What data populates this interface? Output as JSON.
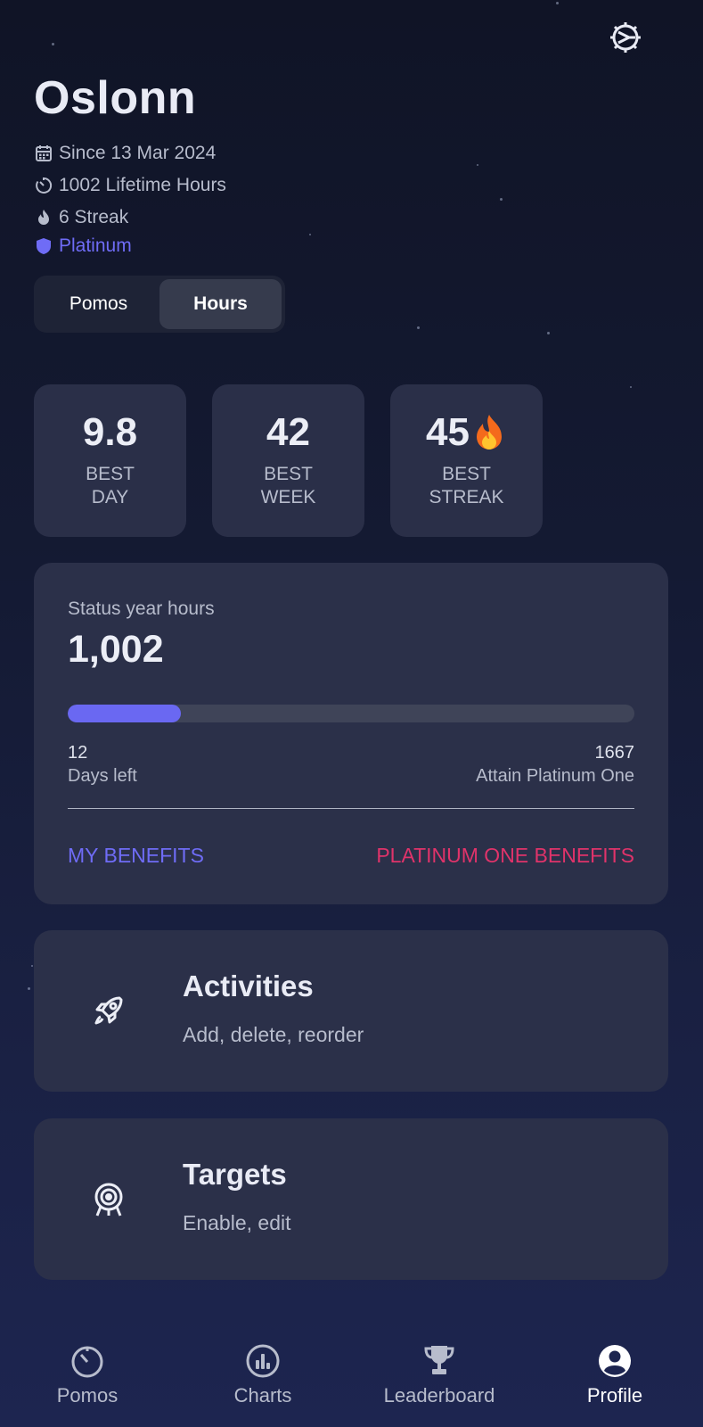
{
  "profile": {
    "name": "Oslonn",
    "since": "Since 13 Mar 2024",
    "lifetime": "1002 Lifetime Hours",
    "streak": "6 Streak",
    "tier": "Platinum"
  },
  "toggle": {
    "options": [
      "Pomos",
      "Hours"
    ],
    "selected": "Hours"
  },
  "stats": [
    {
      "value": "9.8",
      "line1": "BEST",
      "line2": "DAY"
    },
    {
      "value": "42",
      "line1": "BEST",
      "line2": "WEEK"
    },
    {
      "value": "45",
      "emoji": "🔥",
      "line1": "BEST",
      "line2": "STREAK"
    }
  ],
  "status": {
    "label": "Status year hours",
    "value": "1,002",
    "progress": 0.2,
    "days_left_value": "12",
    "days_left_label": "Days left",
    "target_value": "1667",
    "target_label": "Attain Platinum One",
    "my_benefits": "MY BENEFITS",
    "next_benefits": "PLATINUM ONE BENEFITS"
  },
  "menu": [
    {
      "title": "Activities",
      "subtitle": "Add, delete, reorder",
      "icon": "rocket-icon"
    },
    {
      "title": "Targets",
      "subtitle": "Enable, edit",
      "icon": "target-icon"
    }
  ],
  "nav": [
    {
      "label": "Pomos",
      "icon": "timer-icon"
    },
    {
      "label": "Charts",
      "icon": "chart-icon"
    },
    {
      "label": "Leaderboard",
      "icon": "trophy-icon"
    },
    {
      "label": "Profile",
      "icon": "profile-icon",
      "active": true
    }
  ],
  "colors": {
    "accent": "#6F6CF6",
    "pink": "#E0336A",
    "card": "#2B3049"
  }
}
